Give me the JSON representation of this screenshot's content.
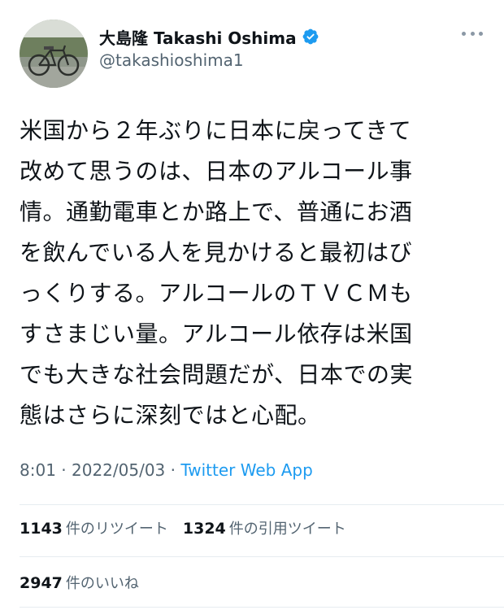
{
  "tweet": {
    "author": {
      "display_name": "大島隆 Takashi Oshima",
      "handle": "@takashioshima1",
      "verified": true,
      "avatar_icon": "avatar-bicycle-photo"
    },
    "text": "米国から２年ぶりに日本に戻ってきて\n改めて思うのは、日本のアルコール事\n情。通勤電車とか路上で、普通にお酒\nを飲んでいる人を見かけると最初はび\nっくりする。アルコールのＴＶＣＭも\nすさまじい量。アルコール依存は米国\nでも大きな社会問題だが、日本での実\n態はさらに深刻ではと心配。",
    "time": "8:01",
    "date": "2022/05/03",
    "separator": " · ",
    "source": "Twitter Web App",
    "retweets": {
      "count": "1143",
      "label": "件のリツイート"
    },
    "quotes": {
      "count": "1324",
      "label": "件の引用ツイート"
    },
    "likes": {
      "count": "2947",
      "label": "件のいいね"
    }
  },
  "colors": {
    "text": "#0f1419",
    "secondary": "#536471",
    "link": "#1d9bf0",
    "verified": "#1d9bf0",
    "divider": "#e6ecf0"
  },
  "icons": {
    "verified": "verified-badge-icon",
    "more": "more-options-icon"
  }
}
